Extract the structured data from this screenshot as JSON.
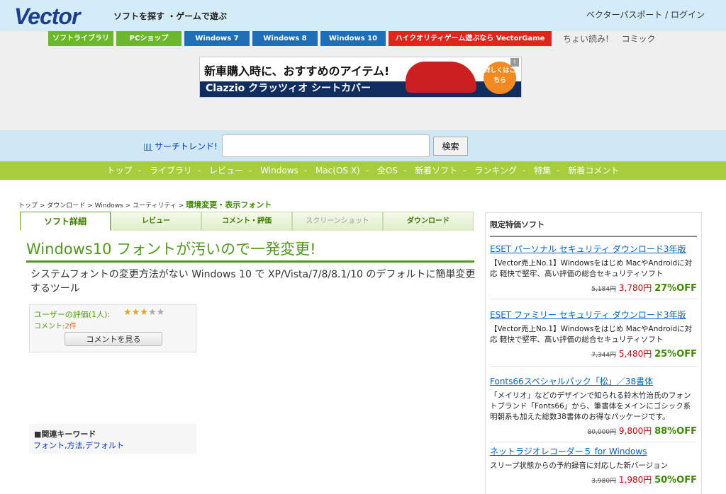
{
  "header": {
    "logo": "Vector",
    "tagline": "ソフトを探す ・ゲームで遊ぶ",
    "passport": "ベクターパスポート / ログイン"
  },
  "nav_buttons": [
    {
      "label": "ソフトライブラリ",
      "color": "#6cb72a"
    },
    {
      "label": "PCショップ",
      "color": "#6cb72a"
    },
    {
      "label": "Windows 7",
      "color": "#1d6fb8"
    },
    {
      "label": "Windows 8",
      "color": "#1d6fb8"
    },
    {
      "label": "Windows 10",
      "color": "#1d6fb8"
    },
    {
      "label": "ハイクオリティゲーム遊ぶなら VectorGame",
      "color": "#e0261b"
    }
  ],
  "extra_links": [
    "ちょい読み!",
    "コミック"
  ],
  "ad": {
    "headline": "新車購入時に、おすすめのアイテム!",
    "sub": "Clazzio クラッツィオ シートカバー",
    "bubble": "詳しくはこちら",
    "info": "i"
  },
  "search": {
    "trend_label": "サーチトレンド!",
    "placeholder": "",
    "button": "検索"
  },
  "green_nav": [
    "トップ",
    "ライブラリ",
    "レビュー",
    "Windows",
    "Mac(OS X)",
    "全OS",
    "新着ソフト",
    "ランキング",
    "特集",
    "新着コメント"
  ],
  "breadcrumb": {
    "items": [
      "トップ",
      "ダウンロード",
      "Windows",
      "ユーティリティ"
    ],
    "current": "環境変更・表示フォント"
  },
  "tabs": [
    {
      "label": "ソフト詳細",
      "state": "active"
    },
    {
      "label": "レビュー",
      "state": "normal"
    },
    {
      "label": "コメント・評価",
      "state": "normal"
    },
    {
      "label": "スクリーンショット",
      "state": "disabled"
    },
    {
      "label": "ダウンロード",
      "state": "normal"
    }
  ],
  "page": {
    "title": "Windows10 フォントが汚いので一発変更!",
    "description": "システムフォントの変更方法がない Windows 10 で XP/Vista/7/8/8.1/10 のデフォルトに簡単変更するツール"
  },
  "rating": {
    "label": "ユーザーの評価(1人):",
    "stars_on": 3,
    "stars_total": 5,
    "comments_label": "コメント:",
    "comments_count": "2件",
    "button": "コメントを見る"
  },
  "keywords": {
    "title": "■関連キーワード",
    "items": [
      "フォント",
      "方法",
      "デフォルト"
    ]
  },
  "sidebar": {
    "header": "限定特価ソフト",
    "items": [
      {
        "title": "ESET パーソナル セキュリティ ダウンロード3年版",
        "desc": "【Vector売上No.1】Windowsをはじめ MacやAndroidに対応 軽快で堅牢、高い評価の総合セキュリティソフト",
        "old": "5,184円",
        "new": "3,780円",
        "off": "27%OFF"
      },
      {
        "title": "ESET ファミリー セキュリティ ダウンロード3年版",
        "desc": "【Vector売上No.1】Windowsをはじめ MacやAndroidに対応 軽快で堅牢、高い評価の総合セキュリティソフト",
        "old": "7,344円",
        "new": "5,480円",
        "off": "25%OFF"
      },
      {
        "title": "Fonts66スペシャルパック「松」／38書体",
        "desc": "「メイリオ」などのデザインで知られる鈴木竹治氏のフォントブランド「Fonts66」から、筆書体をメインにゴシック系明朝系も加えた総数38書体のお得なパッケージです。",
        "old": "80,000円",
        "new": "9,800円",
        "off": "88%OFF"
      },
      {
        "title": "ネットラジオレコーダー５ for Windows",
        "desc": "スリープ状態からの予約録音に対応した新バージョン",
        "old": "3,980円",
        "new": "1,980円",
        "off": "50%OFF"
      }
    ]
  }
}
